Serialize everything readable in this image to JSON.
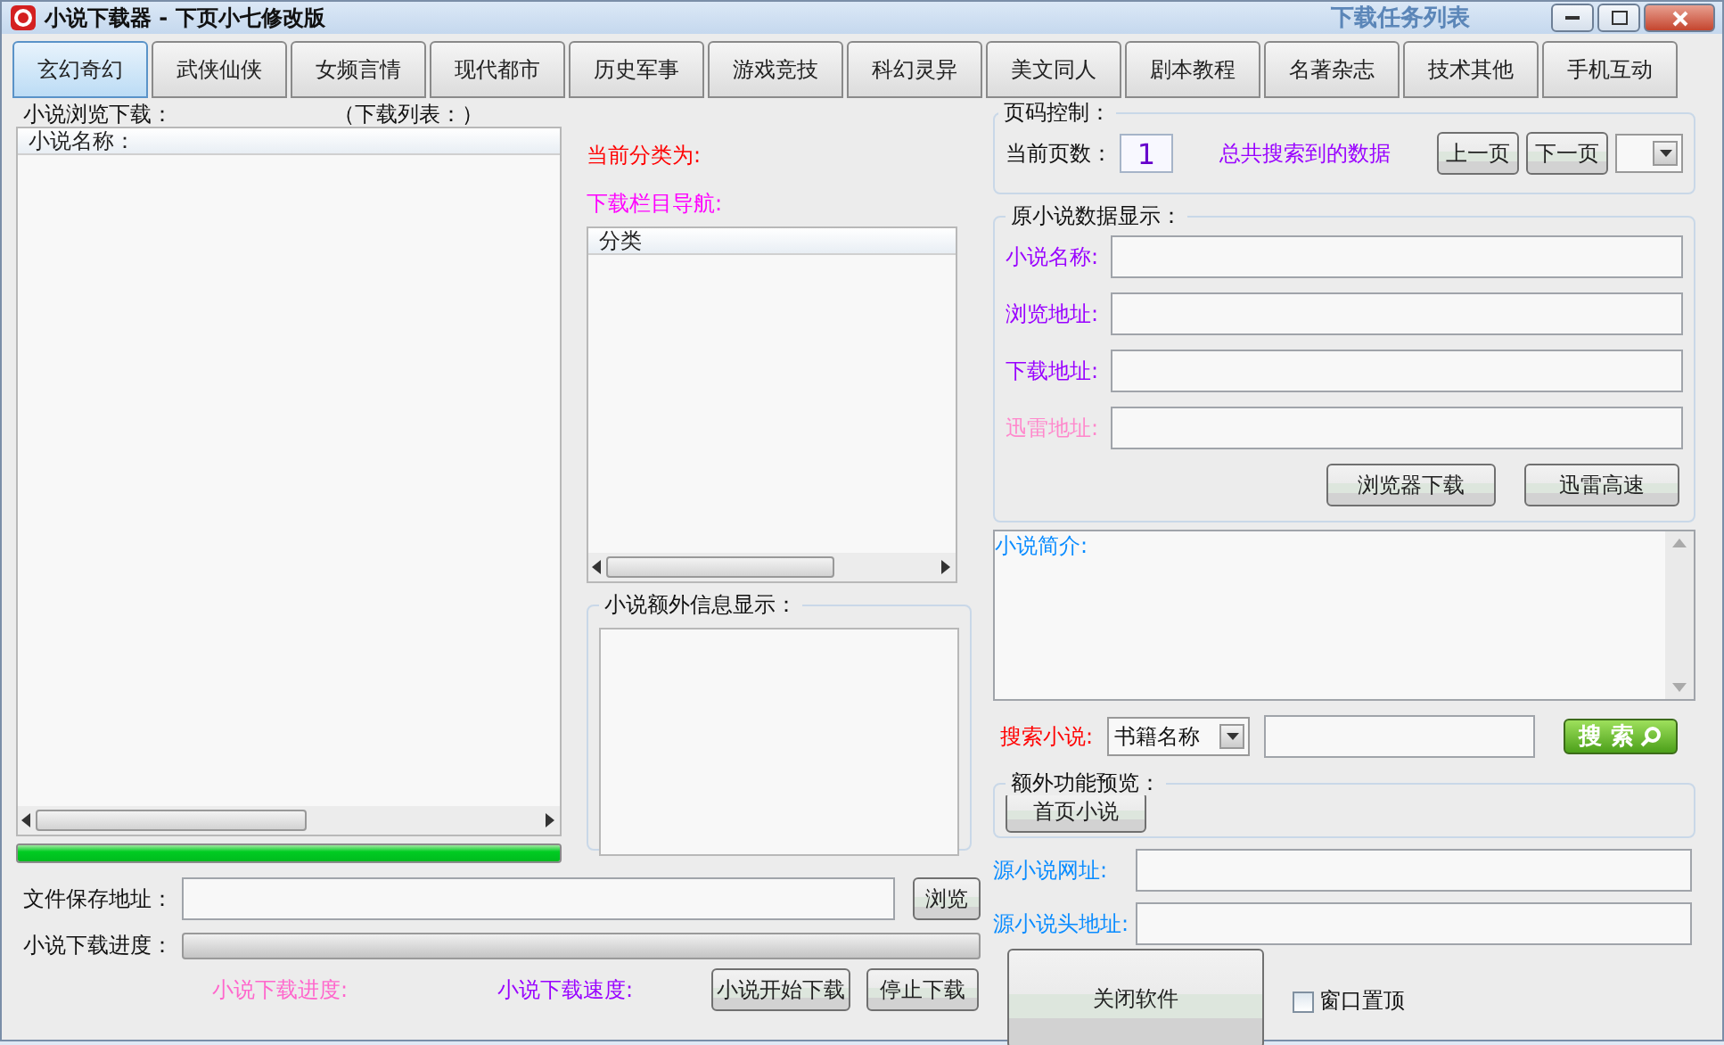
{
  "window": {
    "title": "小说下载器 - 下页小七修改版"
  },
  "background_text": "下载任务列表",
  "tabs": [
    {
      "label": "玄幻奇幻",
      "selected": true
    },
    {
      "label": "武侠仙侠",
      "selected": false
    },
    {
      "label": "女频言情",
      "selected": false
    },
    {
      "label": "现代都市",
      "selected": false
    },
    {
      "label": "历史军事",
      "selected": false
    },
    {
      "label": "游戏竞技",
      "selected": false
    },
    {
      "label": "科幻灵异",
      "selected": false
    },
    {
      "label": "美文同人",
      "selected": false
    },
    {
      "label": "剧本教程",
      "selected": false
    },
    {
      "label": "名著杂志",
      "selected": false
    },
    {
      "label": "技术其他",
      "selected": false
    },
    {
      "label": "手机互动",
      "selected": false
    }
  ],
  "browse_panel": {
    "title": "小说浏览下载：",
    "download_list_label": "（下载列表：）",
    "list_header": "小说名称：",
    "progress": {
      "level": 1
    }
  },
  "category": {
    "current_label": "当前分类为:",
    "nav_label": "下载栏目导航:",
    "list_header": "分类"
  },
  "extra_info": {
    "title": "小说额外信息显示："
  },
  "save_path": {
    "label": "文件保存地址：",
    "button": "浏览"
  },
  "download_progress": {
    "label": "小说下载进度：",
    "level": 0
  },
  "status": [
    {
      "text": "小说下载进度:",
      "color": "#ff66cc"
    },
    {
      "text": "小说下载速度:",
      "color": "#9900ff"
    }
  ],
  "actions": [
    "小说开始下载",
    "停止下载"
  ],
  "paging": {
    "title": "页码控制：",
    "page_label": "当前页数：",
    "page": "1",
    "total_label": "总共搜索到的数据",
    "prev": "上一页",
    "next": "下一页"
  },
  "source_data": {
    "title": "原小说数据显示：",
    "fields": [
      {
        "label": "小说名称:",
        "color": "#9900ff"
      },
      {
        "label": "浏览地址:",
        "color": "#9900ff"
      },
      {
        "label": "下载地址:",
        "color": "#9900ff"
      },
      {
        "label": "迅雷地址:",
        "color": "#ff88cc"
      }
    ],
    "buttons": [
      "浏览器下载",
      "迅雷高速"
    ]
  },
  "intro": {
    "label": "小说简介:"
  },
  "search": {
    "label": "搜索小说:",
    "select": "书籍名称",
    "button": "搜 索"
  },
  "extra_features": {
    "title": "额外功能预览：",
    "button": "首页小说"
  },
  "source_urls": [
    {
      "label": "源小说网址:"
    },
    {
      "label": "源小说头地址:"
    }
  ],
  "close_button": "关闭软件",
  "topmost": {
    "label": "窗口置顶",
    "checked": false
  }
}
